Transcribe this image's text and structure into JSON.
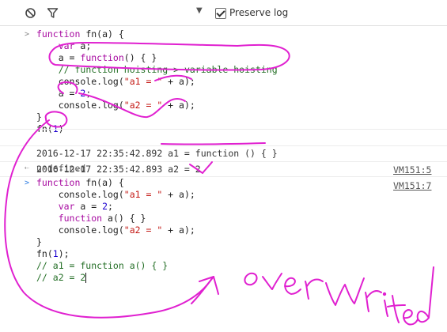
{
  "toolbar": {
    "clear_icon": "clear-console-icon",
    "filter_icon": "filter-icon",
    "dropdown_glyph": "▼",
    "preserve_log_label": "Preserve log",
    "preserve_log_checked": true
  },
  "input1": {
    "prompt": ">",
    "lines": [
      "function fn(a) {",
      "    var a;",
      "    a = function() { }",
      "    // function hoisting > variable hoisting",
      "    console.log(\"a1 = \" + a);",
      "    a = 2;",
      "    console.log(\"a2 = \" + a);",
      "}",
      "fn(1)"
    ]
  },
  "logs": [
    {
      "text": "2016-12-17 22:35:42.892 a1 = function () { }",
      "source": "VM151:5"
    },
    {
      "text": "2016-12-17 22:35:42.893 a2 = 2",
      "source": "VM151:7"
    }
  ],
  "return1": {
    "arrow": "⇠",
    "text": "undefined"
  },
  "input2": {
    "prompt": ">",
    "lines": [
      "function fn(a) {",
      "    console.log(\"a1 = \" + a);",
      "    var a = 2;",
      "    function a() { }",
      "    console.log(\"a2 = \" + a);",
      "}",
      "fn(1);",
      "// a1 = function a() { }",
      "// a2 = 2"
    ]
  },
  "annotation": {
    "handwritten_text": "overwrited",
    "color": "#e020d0"
  }
}
